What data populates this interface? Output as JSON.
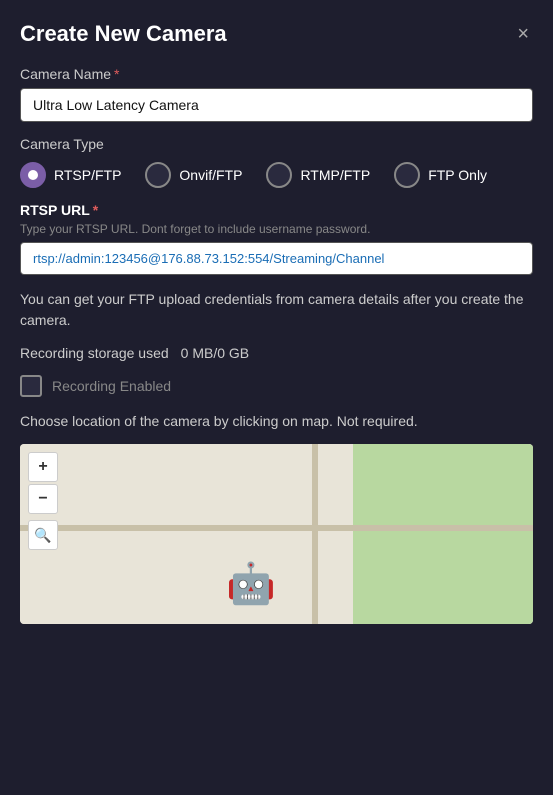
{
  "modal": {
    "title": "Create New Camera",
    "close_label": "×"
  },
  "camera_name": {
    "label": "Camera Name",
    "required": "*",
    "value": "Ultra Low Latency Camera",
    "placeholder": "Camera Name"
  },
  "camera_type": {
    "label": "Camera Type",
    "options": [
      {
        "id": "rtsp",
        "label": "RTSP/FTP",
        "selected": true
      },
      {
        "id": "onvif",
        "label": "Onvif/FTP",
        "selected": false
      },
      {
        "id": "rtmp",
        "label": "RTMP/FTP",
        "selected": false
      },
      {
        "id": "ftp",
        "label": "FTP Only",
        "selected": false
      }
    ]
  },
  "rtsp_url": {
    "label": "RTSP URL",
    "required": "*",
    "hint": "Type your RTSP URL. Dont forget to include username password.",
    "value": "rtsp://admin:123456@176.88.73.152:554/Streaming/Channel"
  },
  "ftp_info": {
    "text": "You can get your FTP upload credentials from camera details after you create the camera."
  },
  "recording_storage": {
    "label": "Recording storage used",
    "value": "0 MB/0 GB"
  },
  "recording_enabled": {
    "label": "Recording Enabled",
    "checked": false
  },
  "location": {
    "text": "Choose location of the camera by clicking on map. Not required."
  },
  "map": {
    "zoom_in": "+",
    "zoom_out": "−",
    "search_icon": "🔍"
  }
}
